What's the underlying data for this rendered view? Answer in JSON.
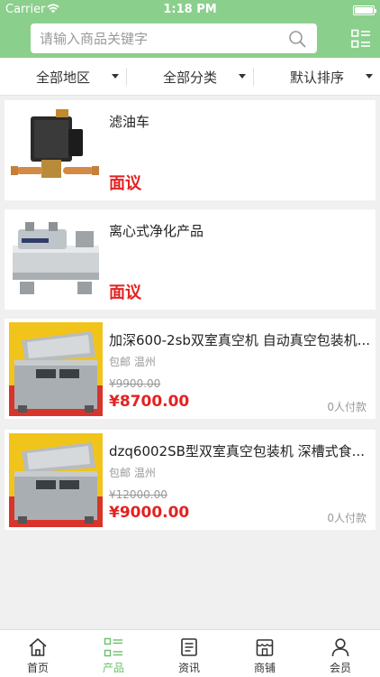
{
  "status_bar": {
    "carrier": "Carrier",
    "time": "1:18 PM"
  },
  "search": {
    "placeholder": "请输入商品关键字",
    "value": ""
  },
  "filters": [
    "全部地区",
    "全部分类",
    "默认排序"
  ],
  "products": [
    {
      "name": "滤油车",
      "price": "面议"
    },
    {
      "name": "离心式净化产品",
      "price": "面议"
    },
    {
      "name": "加深600-2sb双室真空机 自动真空包装机...",
      "shipping": "包邮",
      "city": "温州",
      "old_price": "¥9900.00",
      "price": "¥8700.00",
      "sold": "0人付款"
    },
    {
      "name": "dzq6002SB型双室真空包装机 深槽式食...",
      "shipping": "包邮",
      "city": "温州",
      "old_price": "¥12000.00",
      "price": "¥9000.00",
      "sold": "0人付款"
    }
  ],
  "tabs": [
    "首页",
    "产品",
    "资讯",
    "商铺",
    "会员"
  ],
  "colors": {
    "header": "#8bcf8c",
    "price_red": "#e42222",
    "tab_active": "#6cbf6c"
  }
}
